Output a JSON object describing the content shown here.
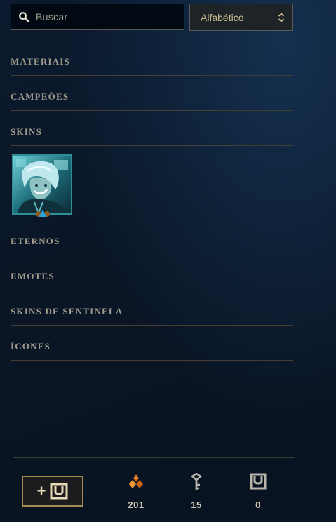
{
  "search": {
    "placeholder": "Buscar",
    "icon": "search-icon"
  },
  "sort": {
    "selected": "Alfabético",
    "icon": "updown-chevron-icon"
  },
  "sections": [
    {
      "label": "MATERIAIS"
    },
    {
      "label": "CAMPEÕES"
    },
    {
      "label": "SKINS"
    },
    {
      "label": "ETERNOS"
    },
    {
      "label": "EMOTES"
    },
    {
      "label": "SKINS DE SENTINELA"
    },
    {
      "label": "ÍCONES"
    }
  ],
  "skins": [
    {
      "icon": "skin-portrait",
      "accent": "#2f8e95"
    }
  ],
  "footer": {
    "store_button_icon": "add-loot-chest-icon",
    "currencies": [
      {
        "icon": "orange-essence-icon",
        "value": "201",
        "color": "#d9761c"
      },
      {
        "icon": "hextech-key-icon",
        "value": "15",
        "color": "#b9b5aa"
      },
      {
        "icon": "chest-icon",
        "value": "0",
        "color": "#b9b5aa"
      }
    ]
  },
  "colors": {
    "gold": "#a68a4e",
    "divider": "#463f31",
    "text": "#a09b8c"
  }
}
